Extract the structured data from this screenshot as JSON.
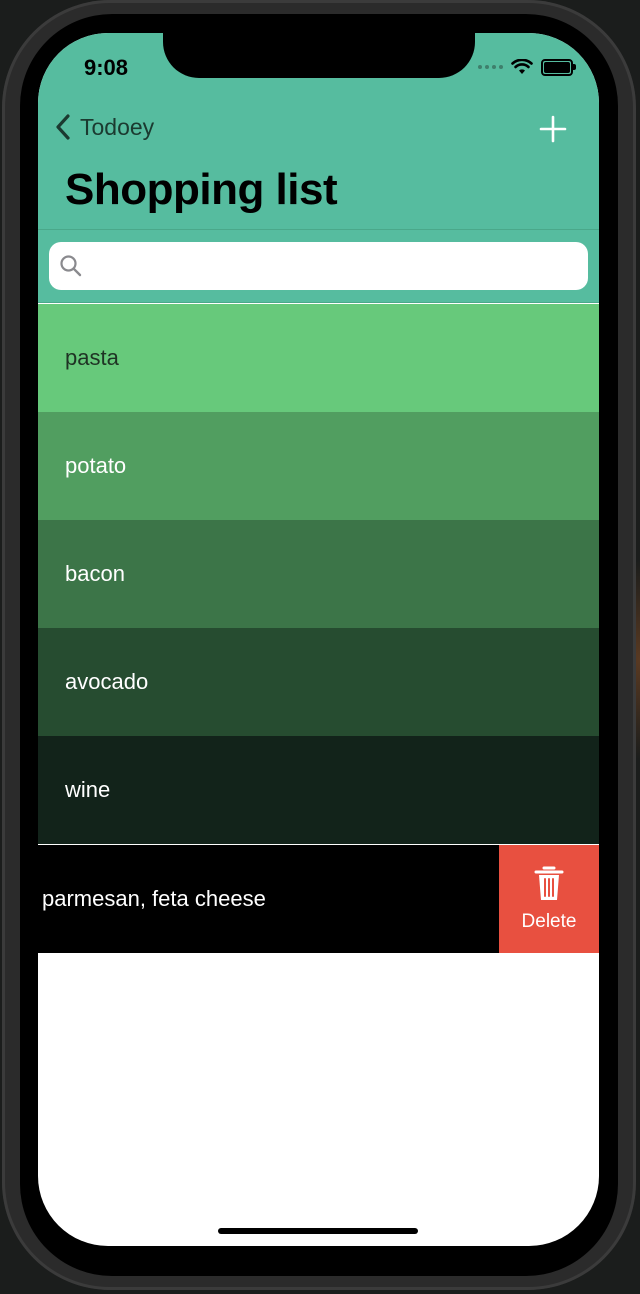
{
  "status_bar": {
    "time": "9:08"
  },
  "nav": {
    "back_label": "Todoey",
    "title": "Shopping list"
  },
  "search": {
    "placeholder": "",
    "value": ""
  },
  "colors": {
    "header": "#56bc9f",
    "delete": "#e85040"
  },
  "items": [
    {
      "label": "pasta",
      "bg": "#67c97b",
      "fg": "#1f3324"
    },
    {
      "label": "potato",
      "bg": "#519e60",
      "fg": "#ffffff"
    },
    {
      "label": "bacon",
      "bg": "#3c7548",
      "fg": "#ffffff"
    },
    {
      "label": "avocado",
      "bg": "#264c30",
      "fg": "#ffffff"
    },
    {
      "label": "wine",
      "bg": "#12231a",
      "fg": "#ffffff"
    }
  ],
  "swiped_item": {
    "label": "parmesan, feta cheese",
    "delete_label": "Delete"
  },
  "icons": {
    "back": "chevron-left-icon",
    "add": "plus-icon",
    "search": "magnifier-icon",
    "delete": "trash-icon"
  }
}
